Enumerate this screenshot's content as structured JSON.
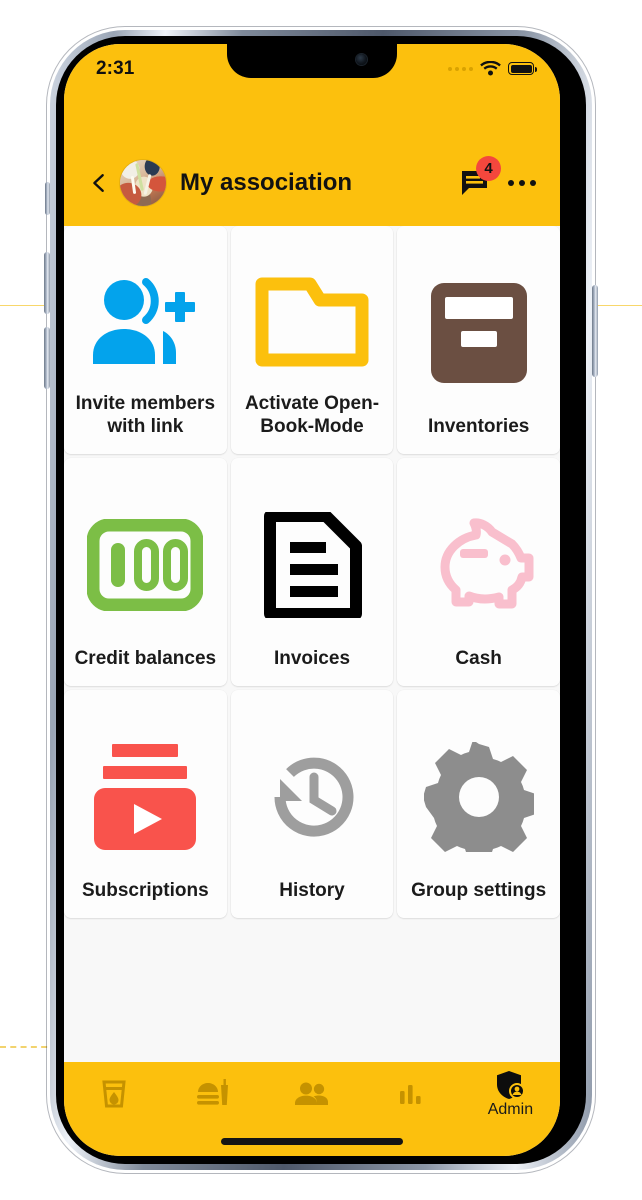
{
  "status_bar": {
    "time": "2:31",
    "signal_icon": "signal-dots-icon",
    "wifi_icon": "wifi-icon",
    "battery_icon": "battery-full-icon"
  },
  "app_bar": {
    "back_icon": "back-chevron-icon",
    "avatar_name": "group-avatar",
    "title": "My association",
    "chat_icon": "chat-bubble-icon",
    "chat_badge": "4",
    "overflow_icon": "more-options-icon"
  },
  "grid": {
    "tiles": [
      {
        "label": "Invite members with link",
        "icon": "person-add-icon",
        "color": "#03A3EC"
      },
      {
        "label": "Activate Open-Book-Mode",
        "icon": "open-folder-icon",
        "color": "#FCC00D"
      },
      {
        "label": "Inventories",
        "icon": "storage-box-icon",
        "color": "#6B4F42"
      },
      {
        "label": "Credit balances",
        "icon": "money-100-icon",
        "color": "#7CBE46"
      },
      {
        "label": "Invoices",
        "icon": "document-lines-icon",
        "color": "#000000"
      },
      {
        "label": "Cash",
        "icon": "piggy-bank-icon",
        "color": "#F9BFCD"
      },
      {
        "label": "Subscriptions",
        "icon": "subscriptions-play-icon",
        "color": "#F9534C"
      },
      {
        "label": "History",
        "icon": "history-clock-icon",
        "color": "#9E9E9E"
      },
      {
        "label": "Group settings",
        "icon": "gear-icon",
        "color": "#8D8D8D"
      }
    ]
  },
  "bottom_nav": {
    "items": [
      {
        "icon": "drink-glass-icon",
        "label": ""
      },
      {
        "icon": "food-meal-icon",
        "label": ""
      },
      {
        "icon": "people-group-icon",
        "label": ""
      },
      {
        "icon": "bar-chart-icon",
        "label": ""
      },
      {
        "icon": "admin-shield-icon",
        "label": "Admin"
      }
    ]
  },
  "theme": {
    "accent_yellow": "#FCC00D",
    "badge_red": "#F4473D",
    "page_background": "#F8F8F8",
    "tile_background": "#FDFDFD",
    "nav_icon_color": "#C59200"
  }
}
